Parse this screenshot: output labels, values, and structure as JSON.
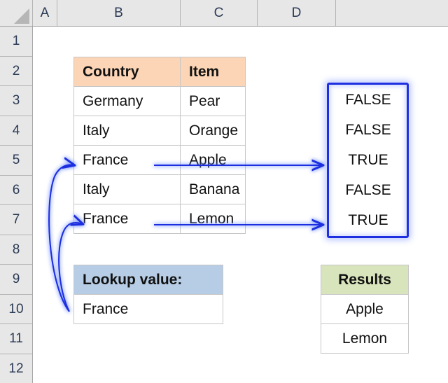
{
  "app": {
    "type": "spreadsheet",
    "select_all_icon": "select-all-triangle-icon"
  },
  "grid": {
    "column_headers": [
      "A",
      "B",
      "C",
      "D"
    ],
    "row_headers": [
      "1",
      "2",
      "3",
      "4",
      "5",
      "6",
      "7",
      "8",
      "9",
      "10",
      "11",
      "12"
    ]
  },
  "main_table": {
    "headers": [
      "Country",
      "Item"
    ],
    "header_fill": "#FBD5B5",
    "rows": [
      {
        "country": "Germany",
        "item": "Pear"
      },
      {
        "country": "Italy",
        "item": "Orange"
      },
      {
        "country": "France",
        "item": "Apple"
      },
      {
        "country": "Italy",
        "item": "Banana"
      },
      {
        "country": "France",
        "item": "Lemon"
      }
    ]
  },
  "bool_column": {
    "values": [
      "FALSE",
      "FALSE",
      "TRUE",
      "FALSE",
      "TRUE"
    ],
    "highlight_color": "#1F2FE0"
  },
  "lookup_table": {
    "header": "Lookup value:",
    "header_fill": "#B7CDE5",
    "value": "France"
  },
  "results_table": {
    "header": "Results",
    "header_fill": "#D8E4BC",
    "values": [
      "Apple",
      "Lemon"
    ]
  },
  "annotations": {
    "arrow_color": "#1F2FE0",
    "arrows": [
      {
        "name": "match-arrow-apple",
        "from": "B5",
        "to": "D5"
      },
      {
        "name": "match-arrow-lemon",
        "from": "B7",
        "to": "D7"
      },
      {
        "name": "lookup-arrow-to-row5",
        "from": "B10",
        "to": "B5"
      },
      {
        "name": "lookup-arrow-to-row7",
        "from": "B10",
        "to": "B7"
      }
    ]
  }
}
